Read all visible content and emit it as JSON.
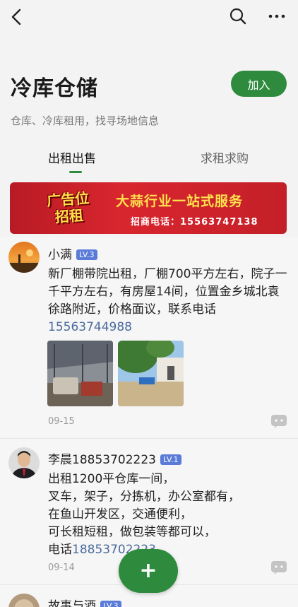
{
  "header": {
    "back_icon": "chevron-left-icon",
    "search_icon": "search-icon",
    "more_icon": "more-dots-icon"
  },
  "group": {
    "title": "冷库仓储",
    "join_label": "加入",
    "subtitle": "仓库、冷库租用，找寻场地信息"
  },
  "tabs": [
    {
      "label": "出租出售",
      "active": true
    },
    {
      "label": "求租求购",
      "active": false
    }
  ],
  "banner": {
    "badge_line1": "广告位",
    "badge_line2": "招租",
    "headline": "大蒜行业一站式服务",
    "phone": "招商电话：15563747138"
  },
  "posts": [
    {
      "author": "小满",
      "level": "LV.3",
      "text": "新厂棚带院出租，厂棚700平方左右，院子一千平方左右，有房屋14间，位置金乡城北袁徐路附近，价格面议，联系电话",
      "phone": "15563744988",
      "date": "09-15"
    },
    {
      "author": "李晨18853702223",
      "level": "LV.1",
      "lines": [
        "出租1200平仓库一间，",
        "叉车，架子，分拣机，办公室都有，",
        "在鱼山开发区，交通便利，",
        "可长租短租，做包装等都可以，"
      ],
      "phone_prefix": "电话",
      "phone": "18853702223",
      "date": "09-14"
    },
    {
      "author": "故事与酒",
      "level": "LV.3"
    }
  ],
  "fab": {
    "label": "+"
  },
  "colors": {
    "accent": "#2e8b3e",
    "link": "#4a6a9c",
    "level_badge": "#5a7bd8",
    "banner": "#d8262e"
  }
}
